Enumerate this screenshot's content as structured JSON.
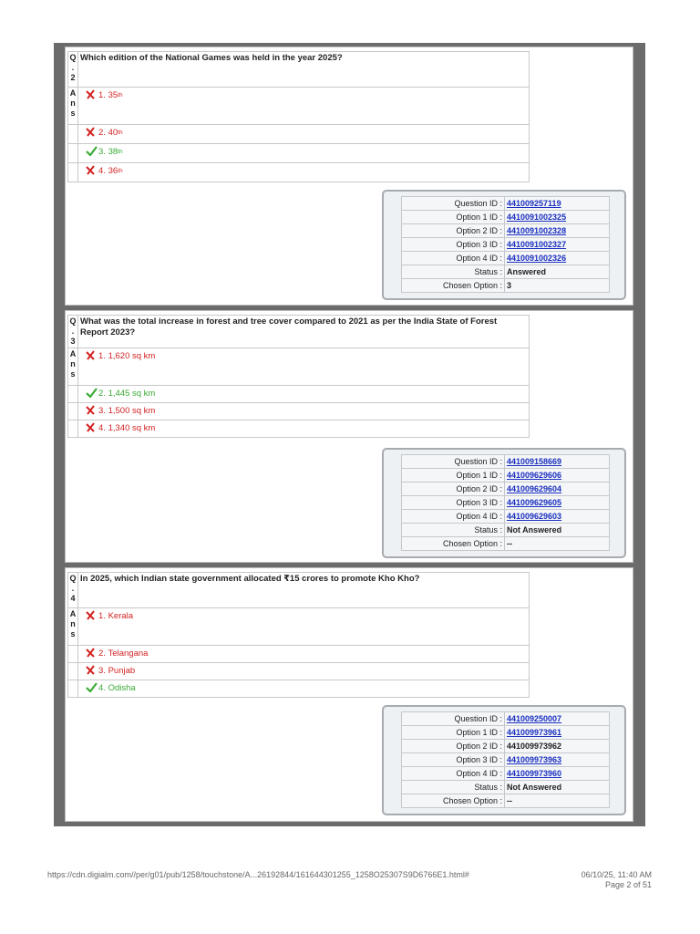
{
  "questions": [
    {
      "q_label": [
        "Q",
        ".",
        "2"
      ],
      "text": "Which edition of the National Games was held in the year 2025?",
      "options": [
        {
          "num": "1.",
          "text": "35",
          "sup": "th",
          "correct": false
        },
        {
          "num": "2.",
          "text": "40",
          "sup": "th",
          "correct": false
        },
        {
          "num": "3.",
          "text": "38",
          "sup": "th",
          "correct": true
        },
        {
          "num": "4.",
          "text": "36",
          "sup": "th",
          "correct": false
        }
      ],
      "info": [
        {
          "key": "Question ID :",
          "value": "441009257119",
          "link": true
        },
        {
          "key": "Option 1 ID :",
          "value": "4410091002325",
          "link": true
        },
        {
          "key": "Option 2 ID :",
          "value": "4410091002328",
          "link": true
        },
        {
          "key": "Option 3 ID :",
          "value": "4410091002327",
          "link": true
        },
        {
          "key": "Option 4 ID :",
          "value": "4410091002326",
          "link": true
        },
        {
          "key": "Status :",
          "value": "Answered",
          "link": false
        },
        {
          "key": "Chosen Option :",
          "value": "3",
          "link": false
        }
      ]
    },
    {
      "q_label": [
        "Q",
        ".",
        "3"
      ],
      "text": "What was the total increase in forest and tree cover compared to 2021 as per the India State of Forest Report 2023?",
      "options": [
        {
          "num": "1.",
          "text": "1,620 sq km",
          "sup": "",
          "correct": false
        },
        {
          "num": "2.",
          "text": "1,445 sq km",
          "sup": "",
          "correct": true
        },
        {
          "num": "3.",
          "text": "1,500 sq km",
          "sup": "",
          "correct": false
        },
        {
          "num": "4.",
          "text": "1,340 sq km",
          "sup": "",
          "correct": false
        }
      ],
      "info": [
        {
          "key": "Question ID :",
          "value": "441009158669",
          "link": true
        },
        {
          "key": "Option 1 ID :",
          "value": "441009629606",
          "link": true
        },
        {
          "key": "Option 2 ID :",
          "value": "441009629604",
          "link": true
        },
        {
          "key": "Option 3 ID :",
          "value": "441009629605",
          "link": true
        },
        {
          "key": "Option 4 ID :",
          "value": "441009629603",
          "link": true
        },
        {
          "key": "Status :",
          "value": "Not Answered",
          "link": false
        },
        {
          "key": "Chosen Option :",
          "value": "--",
          "link": false
        }
      ]
    },
    {
      "q_label": [
        "Q",
        ".",
        "4"
      ],
      "text": "In 2025, which Indian state government allocated ₹15 crores to promote Kho Kho?",
      "options": [
        {
          "num": "1.",
          "text": "Kerala",
          "sup": "",
          "correct": false
        },
        {
          "num": "2.",
          "text": "Telangana",
          "sup": "",
          "correct": false
        },
        {
          "num": "3.",
          "text": "Punjab",
          "sup": "",
          "correct": false
        },
        {
          "num": "4.",
          "text": "Odisha",
          "sup": "",
          "correct": true
        }
      ],
      "info": [
        {
          "key": "Question ID :",
          "value": "441009250007",
          "link": true
        },
        {
          "key": "Option 1 ID :",
          "value": "441009973961",
          "link": true
        },
        {
          "key": "Option 2 ID :",
          "value": "441009973962",
          "link": false
        },
        {
          "key": "Option 3 ID :",
          "value": "441009973963",
          "link": true
        },
        {
          "key": "Option 4 ID :",
          "value": "441009973960",
          "link": true
        },
        {
          "key": "Status :",
          "value": "Not Answered",
          "link": false
        },
        {
          "key": "Chosen Option :",
          "value": "--",
          "link": false
        }
      ]
    }
  ],
  "ans_label": [
    "A",
    "n",
    "s"
  ],
  "footer": {
    "url": "https://cdn.digialm.com//per/g01/pub/1258/touchstone/A...26192844/161644301255_1258O25307S9D6766E1.html#",
    "datetime": "06/10/25, 11:40 AM",
    "page": "Page 2 of 51"
  },
  "colors": {
    "wrong": "#d32222",
    "correct": "#3aaa35",
    "link": "#1a2fbf"
  },
  "icons": {
    "wrong": "cross-icon",
    "correct": "check-icon"
  }
}
